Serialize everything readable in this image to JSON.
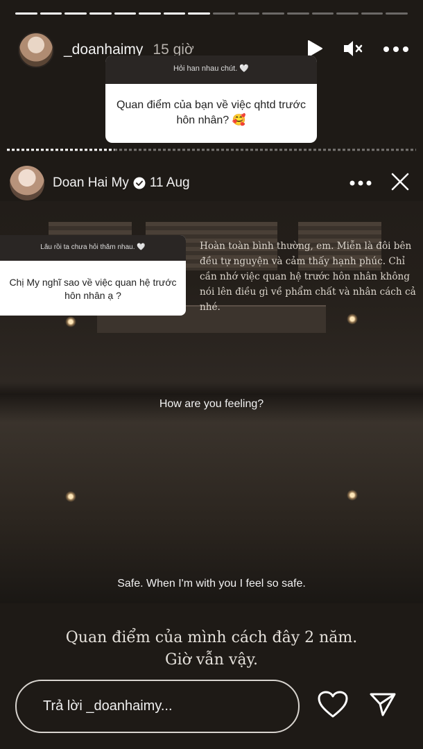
{
  "story": {
    "username": "_doanhaimy",
    "time_ago": "15 giờ",
    "segments_total": 16,
    "segments_done": 8
  },
  "question_box_1": {
    "header": "Hỏi han nhau chút. 🤍",
    "text": "Quan điểm của bạn về việc qhtd trước hôn nhân? 🥰"
  },
  "reposted_story": {
    "display_name": "Doan Hai My",
    "date": "11 Aug"
  },
  "question_box_2": {
    "header": "Lâu rồi ta chưa hỏi thăm nhau. 🤍",
    "text": "Chị My nghĩ sao về việc quan hệ trước hôn nhân ạ ?"
  },
  "answer_text": "Hoàn toàn bình thường, em. Miễn là đôi bên đều tự nguyện và cảm thấy hạnh phúc. Chỉ cần nhớ việc quan hệ trước hôn nhân không nói lên điều gì về phẩm chất và nhân cách cả nhé.",
  "subtitles": {
    "line1": "How are you feeling?",
    "line2": "Safe. When I'm with you I feel so safe."
  },
  "caption": {
    "line1": "Quan điểm của mình cách đây 2 năm.",
    "line2": "Giờ vẫn vậy."
  },
  "reply": {
    "placeholder": "Trả lời _doanhaimy..."
  },
  "icons": {
    "play": "play-icon",
    "mute": "mute-icon",
    "more": "more-icon",
    "close": "close-icon",
    "verified": "verified-icon",
    "heart": "heart-icon",
    "send": "send-icon"
  }
}
